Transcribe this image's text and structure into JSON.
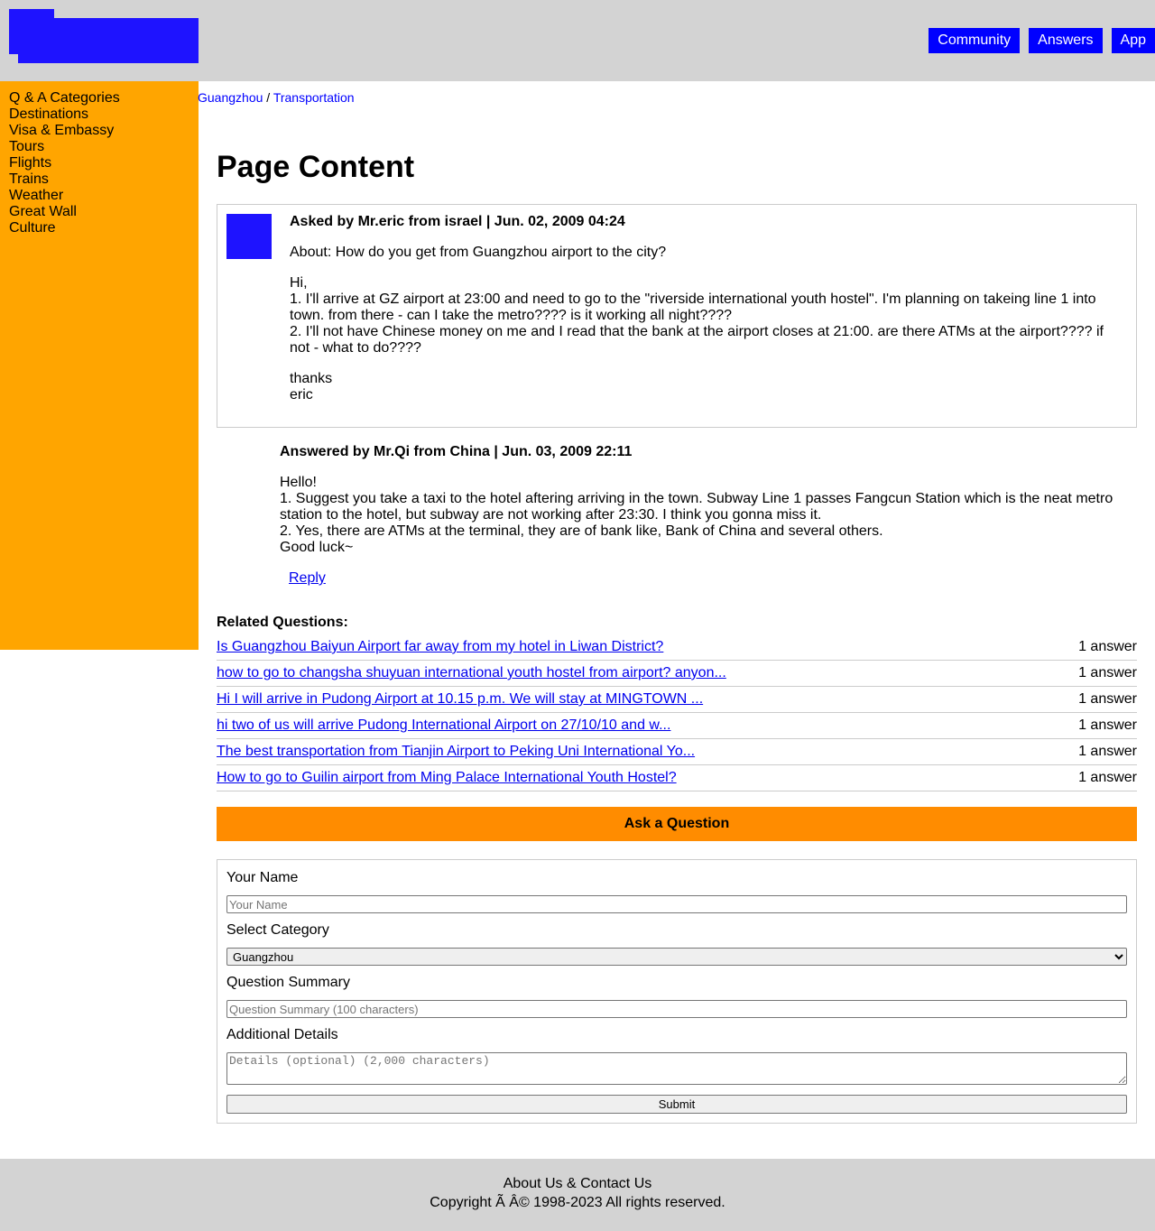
{
  "header": {
    "nav": [
      "Community",
      "Answers",
      "App"
    ]
  },
  "sidebar": {
    "items": [
      "Q & A Categories",
      "Destinations",
      "Visa & Embassy",
      "Tours",
      "Flights",
      "Trains",
      "Weather",
      "Great Wall",
      "Culture"
    ]
  },
  "breadcrumb": {
    "city": "Guangzhou",
    "separator": "/",
    "topic": "Transportation"
  },
  "main": {
    "title": "Page Content"
  },
  "question": {
    "meta": "Asked by Mr.eric from israel | Jun. 02, 2009 04:24",
    "about": "About: How do you get from Guangzhou airport to the city?",
    "greeting": "Hi,",
    "line1": "1. I'll arrive at GZ airport at 23:00 and need to go to the \"riverside international youth hostel\". I'm planning on takeing line 1 into town. from there - can I take the metro???? is it working all night????",
    "line2": "2. I'll not have Chinese money on me and I read that the bank at the airport closes at 21:00. are there ATMs at the airport???? if not - what to do????",
    "thanks": "thanks",
    "signature": "eric"
  },
  "answer": {
    "meta": "Answered by Mr.Qi from China | Jun. 03, 2009 22:11",
    "greeting": "Hello!",
    "line1": "1. Suggest you take a taxi to the hotel aftering arriving in the town. Subway Line 1 passes Fangcun Station which is the neat metro station to the hotel, but subway are not working after 23:30. I think you gonna miss it.",
    "line2": "2. Yes, there are ATMs at the terminal, they are of bank like, Bank of China and several others.",
    "closing": "Good luck~",
    "reply_label": "Reply"
  },
  "related": {
    "title": "Related Questions:",
    "items": [
      {
        "question": "Is Guangzhou Baiyun Airport far away from my hotel in Liwan District?",
        "answers": "1 answer"
      },
      {
        "question": "how to go to changsha shuyuan international youth hostel from airport? anyon...",
        "answers": "1 answer"
      },
      {
        "question": "Hi I will arrive in Pudong Airport at 10.15 p.m. We will stay at MINGTOWN ...",
        "answers": "1 answer"
      },
      {
        "question": "hi two of us will arrive Pudong International Airport on 27/10/10 and w...",
        "answers": "1 answer"
      },
      {
        "question": "The best transportation from Tianjin Airport to Peking Uni International Yo...",
        "answers": "1 answer"
      },
      {
        "question": "How to go to Guilin airport from Ming Palace International Youth Hostel?",
        "answers": "1 answer"
      }
    ]
  },
  "ask": {
    "button_label": "Ask a Question",
    "name_label": "Your Name",
    "name_placeholder": "Your Name",
    "category_label": "Select Category",
    "category_selected": "Guangzhou",
    "summary_label": "Question Summary",
    "summary_placeholder": "Question Summary (100 characters)",
    "details_label": "Additional Details",
    "details_placeholder": "Details (optional) (2,000 characters)",
    "submit_label": "Submit"
  },
  "footer": {
    "links": "About Us & Contact Us",
    "copyright": "Copyright Ã    Â© 1998-2023 All rights reserved."
  },
  "colors": {
    "header_bg": "#d3d3d3",
    "logo": "#1e13ff",
    "nav_bg": "#0000ff",
    "sidebar_bg": "#ffa500",
    "ask_button_bg": "#ff8c00"
  }
}
